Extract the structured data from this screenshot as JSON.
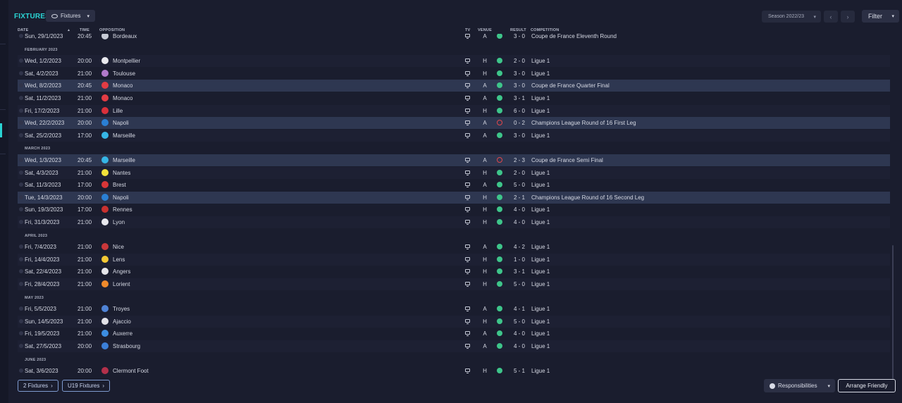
{
  "header": {
    "title": "FIXTURES",
    "view_label": "Fixtures",
    "season_label": "Season 2022/23",
    "filter_label": "Filter"
  },
  "columns": {
    "date": "DATE",
    "sort_arrow": "▲",
    "time": "TIME",
    "opposition": "OPPOSITION",
    "tv": "TV",
    "venue": "VENUE",
    "result": "RESULT",
    "competition": "COMPETITION"
  },
  "items": [
    {
      "kind": "match",
      "date": "Sun, 29/1/2023",
      "time": "20:45",
      "opp": "Bordeaux",
      "venue": "A",
      "result": "win",
      "score": "3 - 0",
      "comp": "Coupe de France Eleventh Round",
      "crest": "#c7cbd6",
      "hl": false
    },
    {
      "kind": "month",
      "label": "FEBRUARY 2023"
    },
    {
      "kind": "match",
      "date": "Wed, 1/2/2023",
      "time": "20:00",
      "opp": "Montpellier",
      "venue": "H",
      "result": "win",
      "score": "2 - 0",
      "comp": "Ligue 1",
      "crest": "#e9e9ee",
      "hl": false
    },
    {
      "kind": "match",
      "date": "Sat, 4/2/2023",
      "time": "21:00",
      "opp": "Toulouse",
      "venue": "H",
      "result": "win",
      "score": "3 - 0",
      "comp": "Ligue 1",
      "crest": "#b17acb",
      "hl": false
    },
    {
      "kind": "match",
      "date": "Wed, 8/2/2023",
      "time": "20:45",
      "opp": "Monaco",
      "venue": "A",
      "result": "win",
      "score": "3 - 0",
      "comp": "Coupe de France Quarter Final",
      "crest": "#e23c44",
      "hl": true
    },
    {
      "kind": "match",
      "date": "Sat, 11/2/2023",
      "time": "21:00",
      "opp": "Monaco",
      "venue": "A",
      "result": "win",
      "score": "3 - 1",
      "comp": "Ligue 1",
      "crest": "#e23c44",
      "hl": false
    },
    {
      "kind": "match",
      "date": "Fri, 17/2/2023",
      "time": "21:00",
      "opp": "Lille",
      "venue": "H",
      "result": "win",
      "score": "6 - 0",
      "comp": "Ligue 1",
      "crest": "#d9303a",
      "hl": false
    },
    {
      "kind": "match",
      "date": "Wed, 22/2/2023",
      "time": "20:00",
      "opp": "Napoli",
      "venue": "A",
      "result": "loss",
      "score": "0 - 2",
      "comp": "Champions League Round of 16  First Leg",
      "crest": "#2a7fd4",
      "hl": true
    },
    {
      "kind": "match",
      "date": "Sat, 25/2/2023",
      "time": "17:00",
      "opp": "Marseille",
      "venue": "A",
      "result": "win",
      "score": "3 - 0",
      "comp": "Ligue 1",
      "crest": "#36b6e6",
      "hl": false
    },
    {
      "kind": "month",
      "label": "MARCH 2023"
    },
    {
      "kind": "match",
      "date": "Wed, 1/3/2023",
      "time": "20:45",
      "opp": "Marseille",
      "venue": "A",
      "result": "loss",
      "score": "2 - 3",
      "comp": "Coupe de France Semi Final",
      "crest": "#36b6e6",
      "hl": true
    },
    {
      "kind": "match",
      "date": "Sat, 4/3/2023",
      "time": "21:00",
      "opp": "Nantes",
      "venue": "H",
      "result": "win",
      "score": "2 - 0",
      "comp": "Ligue 1",
      "crest": "#f1e13a",
      "hl": false
    },
    {
      "kind": "match",
      "date": "Sat, 11/3/2023",
      "time": "17:00",
      "opp": "Brest",
      "venue": "A",
      "result": "win",
      "score": "5 - 0",
      "comp": "Ligue 1",
      "crest": "#d83638",
      "hl": false
    },
    {
      "kind": "match",
      "date": "Tue, 14/3/2023",
      "time": "20:00",
      "opp": "Napoli",
      "venue": "H",
      "result": "win",
      "score": "2 - 1",
      "comp": "Champions League Round of 16  Second Leg",
      "crest": "#2a7fd4",
      "hl": true
    },
    {
      "kind": "match",
      "date": "Sun, 19/3/2023",
      "time": "17:00",
      "opp": "Rennes",
      "venue": "H",
      "result": "win",
      "score": "4 - 0",
      "comp": "Ligue 1",
      "crest": "#c8312f",
      "hl": false
    },
    {
      "kind": "match",
      "date": "Fri, 31/3/2023",
      "time": "21:00",
      "opp": "Lyon",
      "venue": "H",
      "result": "win",
      "score": "4 - 0",
      "comp": "Ligue 1",
      "crest": "#e8e8ee",
      "hl": false
    },
    {
      "kind": "month",
      "label": "APRIL 2023"
    },
    {
      "kind": "match",
      "date": "Fri, 7/4/2023",
      "time": "21:00",
      "opp": "Nice",
      "venue": "A",
      "result": "win",
      "score": "4 - 2",
      "comp": "Ligue 1",
      "crest": "#c9373a",
      "hl": false
    },
    {
      "kind": "match",
      "date": "Fri, 14/4/2023",
      "time": "21:00",
      "opp": "Lens",
      "venue": "H",
      "result": "win",
      "score": "1 - 0",
      "comp": "Ligue 1",
      "crest": "#f3c834",
      "hl": false
    },
    {
      "kind": "match",
      "date": "Sat, 22/4/2023",
      "time": "21:00",
      "opp": "Angers",
      "venue": "H",
      "result": "win",
      "score": "3 - 1",
      "comp": "Ligue 1",
      "crest": "#e6e6ea",
      "hl": false
    },
    {
      "kind": "match",
      "date": "Fri, 28/4/2023",
      "time": "21:00",
      "opp": "Lorient",
      "venue": "H",
      "result": "win",
      "score": "5 - 0",
      "comp": "Ligue 1",
      "crest": "#f08a2c",
      "hl": false
    },
    {
      "kind": "month",
      "label": "MAY 2023"
    },
    {
      "kind": "match",
      "date": "Fri, 5/5/2023",
      "time": "21:00",
      "opp": "Troyes",
      "venue": "A",
      "result": "win",
      "score": "4 - 1",
      "comp": "Ligue 1",
      "crest": "#4f83d6",
      "hl": false
    },
    {
      "kind": "match",
      "date": "Sun, 14/5/2023",
      "time": "21:00",
      "opp": "Ajaccio",
      "venue": "H",
      "result": "win",
      "score": "5 - 0",
      "comp": "Ligue 1",
      "crest": "#e2e2e8",
      "hl": false
    },
    {
      "kind": "match",
      "date": "Fri, 19/5/2023",
      "time": "21:00",
      "opp": "Auxerre",
      "venue": "A",
      "result": "win",
      "score": "4 - 0",
      "comp": "Ligue 1",
      "crest": "#3c8de0",
      "hl": false
    },
    {
      "kind": "match",
      "date": "Sat, 27/5/2023",
      "time": "20:00",
      "opp": "Strasbourg",
      "venue": "A",
      "result": "win",
      "score": "4 - 0",
      "comp": "Ligue 1",
      "crest": "#3b7fd8",
      "hl": false
    },
    {
      "kind": "month",
      "label": "JUNE 2023"
    },
    {
      "kind": "match",
      "date": "Sat, 3/6/2023",
      "time": "20:00",
      "opp": "Clermont Foot",
      "venue": "H",
      "result": "win",
      "score": "5 - 1",
      "comp": "Ligue 1",
      "crest": "#b3304a",
      "hl": false
    }
  ],
  "footer": {
    "btn1": "2 Fixtures",
    "btn2": "U19 Fixtures",
    "responsibilities": "Responsibilities",
    "arrange": "Arrange Friendly"
  }
}
